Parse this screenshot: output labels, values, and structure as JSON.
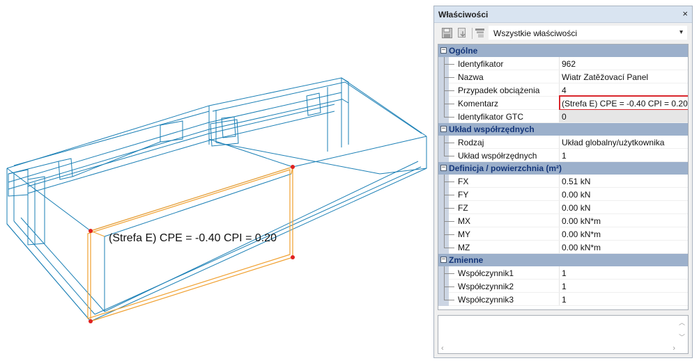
{
  "viewport": {
    "label": "(Strefa E) CPE = -0.40 CPI = 0.20",
    "colors": {
      "structure": "#1a7fb5",
      "selection": "#f0a030",
      "nodes": "#e02020"
    }
  },
  "panel": {
    "title": "Właściwości",
    "close": "×",
    "toolbar": {
      "filter_value": "Wszystkie właściwości",
      "dropdown_arrow": "▾",
      "icons": [
        "save-icon",
        "import-icon",
        "properties-filter-icon"
      ]
    },
    "categories": [
      {
        "title": "Ogólne",
        "toggle": "−",
        "rows": [
          {
            "name": "Identyfikator",
            "value": "962"
          },
          {
            "name": "Nazwa",
            "value": "Wiatr Zatěžovací Panel"
          },
          {
            "name": "Przypadek obciążenia",
            "value": "4"
          },
          {
            "name": "Komentarz",
            "value": "(Strefa E) CPE = -0.40 CPI = 0.20",
            "highlighted": true
          },
          {
            "name": "Identyfikator GTC",
            "value": "0",
            "readonly": true
          }
        ]
      },
      {
        "title": "Układ współrzędnych",
        "toggle": "−",
        "rows": [
          {
            "name": "Rodzaj",
            "value": "Układ globalny/użytkownika"
          },
          {
            "name": "Układ współrzędnych",
            "value": "1"
          }
        ]
      },
      {
        "title": "Definicja / powierzchnia (m²)",
        "toggle": "−",
        "rows": [
          {
            "name": "FX",
            "value": "0.51 kN"
          },
          {
            "name": "FY",
            "value": "0.00 kN"
          },
          {
            "name": "FZ",
            "value": "0.00 kN"
          },
          {
            "name": "MX",
            "value": "0.00 kN*m"
          },
          {
            "name": "MY",
            "value": "0.00 kN*m"
          },
          {
            "name": "MZ",
            "value": "0.00 kN*m"
          }
        ]
      },
      {
        "title": "Zmienne",
        "toggle": "−",
        "rows": [
          {
            "name": "Współczynnik1",
            "value": "1"
          },
          {
            "name": "Współczynnik2",
            "value": "1"
          },
          {
            "name": "Współczynnik3",
            "value": "1"
          }
        ]
      }
    ],
    "description": {
      "scroll_up": "︿",
      "scroll_down": "﹀",
      "scroll_left": "‹",
      "scroll_right": "›"
    }
  }
}
